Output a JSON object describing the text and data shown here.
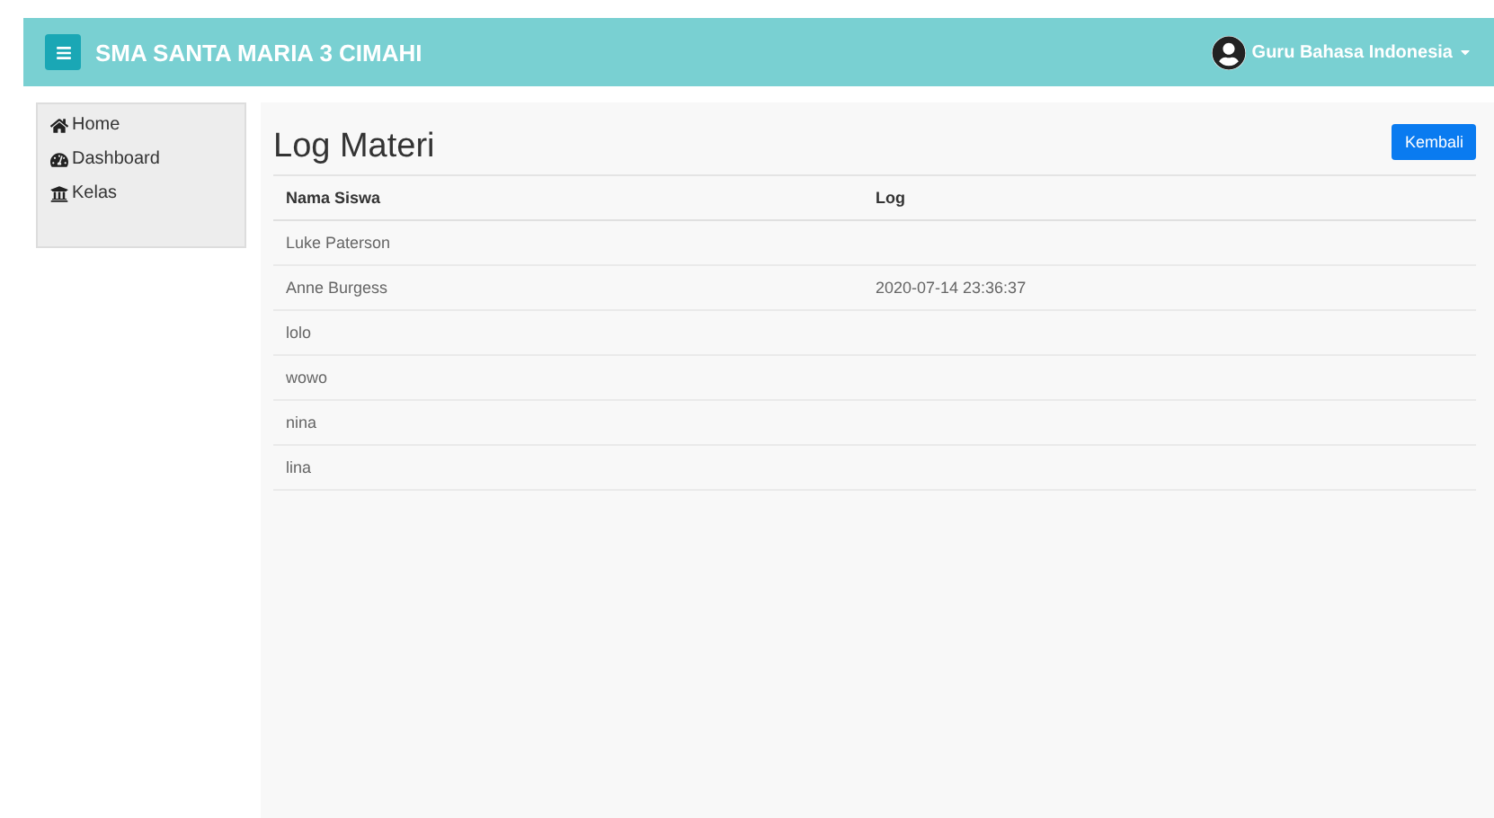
{
  "navbar": {
    "brand": "SMA SANTA MARIA 3 CIMAHI",
    "user": "Guru Bahasa Indonesia"
  },
  "sidebar": {
    "items": [
      {
        "label": "Home"
      },
      {
        "label": "Dashboard"
      },
      {
        "label": "Kelas"
      }
    ]
  },
  "page": {
    "title": "Log Materi",
    "back_button": "Kembali"
  },
  "table": {
    "columns": [
      "Nama Siswa",
      "Log"
    ],
    "rows": [
      [
        "Luke Paterson",
        ""
      ],
      [
        "Anne Burgess",
        "2020-07-14 23:36:37"
      ],
      [
        "lolo",
        ""
      ],
      [
        "wowo",
        ""
      ],
      [
        "nina",
        ""
      ],
      [
        "lina",
        ""
      ]
    ]
  }
}
